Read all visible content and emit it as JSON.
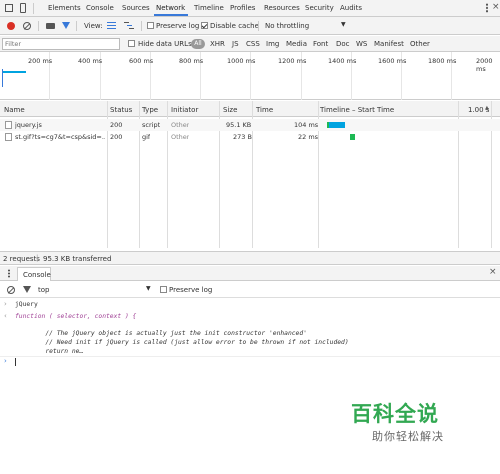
{
  "tabs": [
    "Elements",
    "Console",
    "Sources",
    "Network",
    "Timeline",
    "Profiles",
    "Resources",
    "Security",
    "Audits"
  ],
  "toolbar": {
    "view_label": "View:",
    "preserve_log": "Preserve log",
    "disable_cache": "Disable cache",
    "throttling": "No throttling"
  },
  "filter": {
    "placeholder": "Filter",
    "hide_data_urls": "Hide data URLs",
    "all": "All",
    "types": [
      "XHR",
      "JS",
      "CSS",
      "Img",
      "Media",
      "Font",
      "Doc",
      "WS",
      "Manifest",
      "Other"
    ]
  },
  "overview_ticks": [
    "200 ms",
    "400 ms",
    "600 ms",
    "800 ms",
    "1000 ms",
    "1200 ms",
    "1400 ms",
    "1600 ms",
    "1800 ms",
    "2000 ms"
  ],
  "columns": {
    "name": "Name",
    "status": "Status",
    "type": "Type",
    "initiator": "Initiator",
    "size": "Size",
    "time": "Time",
    "timeline": "Timeline – Start Time",
    "timeline_tick": "1.00 s"
  },
  "requests": [
    {
      "name": "jquery.js",
      "status": "200",
      "type": "script",
      "initiator": "Other",
      "size": "95.1 KB",
      "time": "104 ms"
    },
    {
      "name": "st.gif?ts=cg7&t=csp&sid=...",
      "status": "200",
      "type": "gif",
      "initiator": "Other",
      "size": "273 B",
      "time": "22 ms"
    }
  ],
  "status_summary": "2 requests",
  "status_transferred": "95.3 KB transferred",
  "drawer_tab": "Console",
  "console": {
    "context": "top",
    "preserve_log": "Preserve log",
    "input_echo": "jQuery",
    "output_lines": [
      "function ( selector, context ) {",
      "",
      "        // The jQuery object is actually just the init constructor 'enhanced'",
      "        // Need init if jQuery is called (just allow error to be thrown if not included)",
      "        return ne…"
    ]
  },
  "watermark": {
    "title": "百科全说",
    "subtitle": "助你轻松解决"
  },
  "colors": {
    "accent_blue": "#3879d9",
    "record_red": "#d93025",
    "filter_blue": "#3879d9",
    "waterfall_blue": "#00a3e0",
    "waterfall_green": "#1db954",
    "watermark_green": "#32a852"
  }
}
